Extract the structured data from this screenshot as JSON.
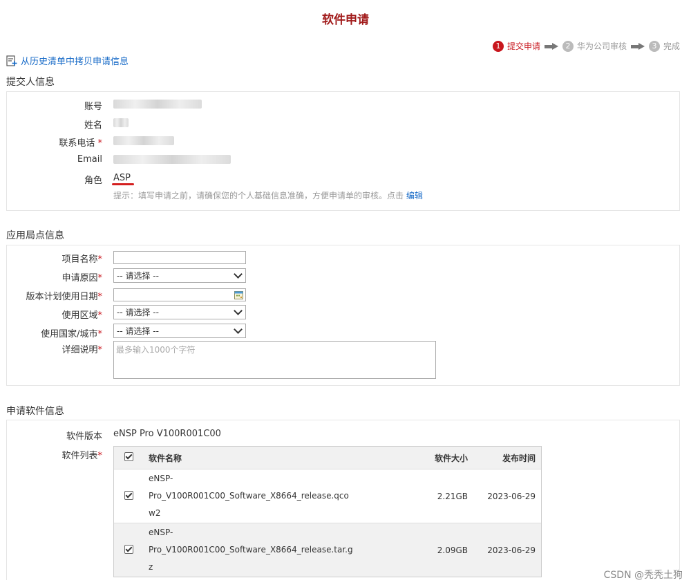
{
  "page_title": "软件申请",
  "steps": [
    {
      "num": "1",
      "label": "提交申请"
    },
    {
      "num": "2",
      "label": "华为公司审核"
    },
    {
      "num": "3",
      "label": "完成"
    }
  ],
  "copy_link": "从历史清单中拷贝申请信息",
  "submitter": {
    "section_title": "提交人信息",
    "account_label": "账号",
    "name_label": "姓名",
    "phone_label": "联系电话",
    "email_label": "Email",
    "role_label": "角色",
    "role_value": "ASP",
    "hint": "提示：填写申请之前，请确保您的个人基础信息准确，方便申请单的审核。点击",
    "edit_link": "编辑"
  },
  "site": {
    "section_title": "应用局点信息",
    "project_label": "项目名称",
    "reason_label": "申请原因",
    "reason_value": "-- 请选择 --",
    "date_label": "版本计划使用日期",
    "region_label": "使用区域",
    "region_value": "-- 请选择 --",
    "country_label": "使用国家/城市",
    "country_value": "-- 请选择 --",
    "detail_label": "详细说明",
    "detail_placeholder": "最多输入1000个字符"
  },
  "software": {
    "section_title": "申请软件信息",
    "version_label": "软件版本",
    "version_value": "eNSP Pro V100R001C00",
    "list_label": "软件列表",
    "columns": {
      "name": "软件名称",
      "size": "软件大小",
      "date": "发布时间"
    },
    "rows": [
      {
        "name_l1": "eNSP-",
        "name_l2": "Pro_V100R001C00_Software_X8664_release.qco",
        "name_l3": "w2",
        "size": "2.21GB",
        "date": "2023-06-29",
        "checked": true
      },
      {
        "name_l1": "eNSP-",
        "name_l2": "Pro_V100R001C00_Software_X8664_release.tar.g",
        "name_l3": "z",
        "size": "2.09GB",
        "date": "2023-06-29",
        "checked": true
      }
    ]
  },
  "required_mark": "*",
  "watermark": "CSDN @秃秃土狗",
  "colors": {
    "title": "#a11a1a",
    "accent_red": "#c8161d",
    "link": "#1569c7"
  }
}
